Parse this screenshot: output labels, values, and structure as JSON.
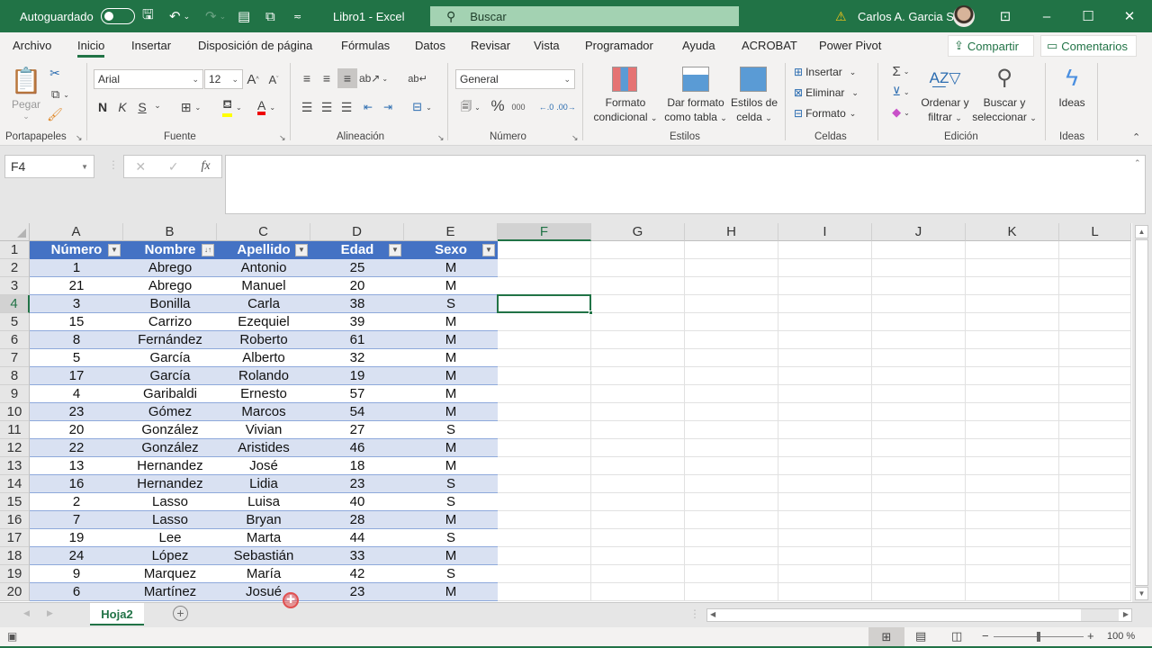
{
  "titlebar": {
    "autosave_label": "Autoguardado",
    "autosave_state": "off",
    "doc_title": "Libro1  -  Excel",
    "search_placeholder": "Buscar",
    "user_name": "Carlos A. Garcia S.",
    "icons": [
      "save-icon",
      "undo-icon",
      "redo-icon",
      "form-icon",
      "camera-icon",
      "customize-qat-icon"
    ]
  },
  "menu": {
    "tabs": [
      "Archivo",
      "Inicio",
      "Insertar",
      "Disposición de página",
      "Fórmulas",
      "Datos",
      "Revisar",
      "Vista",
      "Programador",
      "Ayuda",
      "ACROBAT",
      "Power Pivot"
    ],
    "active_tab": "Inicio",
    "share_label": "Compartir",
    "comments_label": "Comentarios"
  },
  "ribbon": {
    "clipboard": {
      "label": "Portapapeles",
      "paste": "Pegar"
    },
    "font": {
      "label": "Fuente",
      "font_name": "Arial",
      "font_size": "12",
      "bold": "N",
      "italic": "K",
      "underline": "S"
    },
    "alignment": {
      "label": "Alineación"
    },
    "number": {
      "label": "Número",
      "format": "General",
      "thousands": "000"
    },
    "styles": {
      "label": "Estilos",
      "cond_format_1": "Formato",
      "cond_format_2": "condicional",
      "table_1": "Dar formato",
      "table_2": "como tabla",
      "cell_styles_1": "Estilos de",
      "cell_styles_2": "celda"
    },
    "cells": {
      "label": "Celdas",
      "insert": "Insertar",
      "delete": "Eliminar",
      "format": "Formato"
    },
    "editing": {
      "label": "Edición",
      "sort_1": "Ordenar y",
      "sort_2": "filtrar",
      "find_1": "Buscar y",
      "find_2": "seleccionar"
    },
    "ideas": {
      "label": "Ideas",
      "button": "Ideas"
    }
  },
  "formula_bar": {
    "name_box": "F4",
    "formula": ""
  },
  "grid": {
    "columns": [
      "A",
      "B",
      "C",
      "D",
      "E",
      "F",
      "G",
      "H",
      "I",
      "J",
      "K",
      "L"
    ],
    "selected_column": "F",
    "selected_row": 4,
    "selected_cell": "F4",
    "rows": [
      1,
      2,
      3,
      4,
      5,
      6,
      7,
      8,
      9,
      10,
      11,
      12,
      13,
      14,
      15,
      16,
      17,
      18,
      19,
      20
    ],
    "table_headers": [
      "Número",
      "Nombre",
      "Apellido",
      "Edad",
      "Sexo"
    ],
    "sorted_column": "Nombre",
    "table_rows": [
      [
        "1",
        "Abrego",
        "Antonio",
        "25",
        "M"
      ],
      [
        "21",
        "Abrego",
        "Manuel",
        "20",
        "M"
      ],
      [
        "3",
        "Bonilla",
        "Carla",
        "38",
        "S"
      ],
      [
        "15",
        "Carrizo",
        "Ezequiel",
        "39",
        "M"
      ],
      [
        "8",
        "Fernández",
        "Roberto",
        "61",
        "M"
      ],
      [
        "5",
        "García",
        "Alberto",
        "32",
        "M"
      ],
      [
        "17",
        "García",
        "Rolando",
        "19",
        "M"
      ],
      [
        "4",
        "Garibaldi",
        "Ernesto",
        "57",
        "M"
      ],
      [
        "23",
        "Gómez",
        "Marcos",
        "54",
        "M"
      ],
      [
        "20",
        "González",
        "Vivian",
        "27",
        "S"
      ],
      [
        "22",
        "González",
        "Aristides",
        "46",
        "M"
      ],
      [
        "13",
        "Hernandez",
        "José",
        "18",
        "M"
      ],
      [
        "16",
        "Hernandez",
        "Lidia",
        "23",
        "S"
      ],
      [
        "2",
        "Lasso",
        "Luisa",
        "40",
        "S"
      ],
      [
        "7",
        "Lasso",
        "Bryan",
        "28",
        "M"
      ],
      [
        "19",
        "Lee",
        "Marta",
        "44",
        "S"
      ],
      [
        "24",
        "López",
        "Sebastián",
        "33",
        "M"
      ],
      [
        "9",
        "Marquez",
        "María",
        "42",
        "S"
      ],
      [
        "6",
        "Martínez",
        "Josué",
        "23",
        "M"
      ]
    ]
  },
  "sheets": {
    "tabs": [
      "Hoja2"
    ],
    "active": "Hoja2"
  },
  "statusbar": {
    "zoom": "100 %",
    "zoom_fraction": 0.5
  },
  "colors": {
    "excel_green": "#217346",
    "table_header": "#4472c4",
    "table_band": "#d9e1f2"
  }
}
